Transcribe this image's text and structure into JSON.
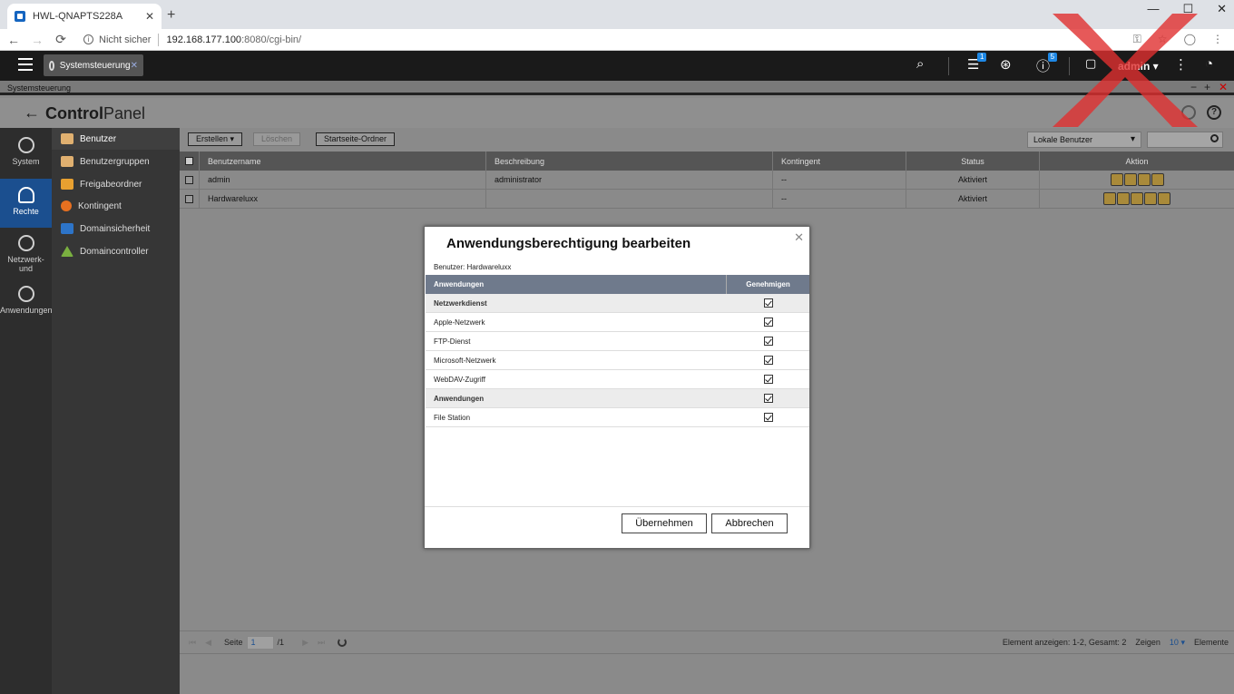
{
  "browser": {
    "tab_title": "HWL-QNAPTS228A",
    "tab_close": "✕",
    "new_tab": "+",
    "security_label": "Nicht sicher",
    "url_host": "192.168.177.100",
    "url_rest": ":8080/cgi-bin/",
    "window_controls": [
      "—",
      "☐",
      "✕"
    ]
  },
  "qnap_bar": {
    "app_tab_label": "Systemsteuerung",
    "app_tab_close": "✕",
    "tasks_badge": "1",
    "notifications_badge": "5",
    "user_label": "admin ▾"
  },
  "window": {
    "title": "Systemsteuerung",
    "controls": [
      "−",
      "+",
      "✕"
    ]
  },
  "header": {
    "back": "←",
    "title_bold": "Control",
    "title_light": "Panel"
  },
  "rail": [
    {
      "label": "System"
    },
    {
      "label": "Rechte"
    },
    {
      "label": "Netzwerk- und"
    },
    {
      "label": "Anwendungen"
    }
  ],
  "subnav": [
    {
      "label": "Benutzer",
      "color": "#e0b070"
    },
    {
      "label": "Benutzergruppen",
      "color": "#e0b070"
    },
    {
      "label": "Freigabeordner",
      "color": "#e8a030"
    },
    {
      "label": "Kontingent",
      "color": "#e87020"
    },
    {
      "label": "Domainsicherheit",
      "color": "#2d74c8"
    },
    {
      "label": "Domaincontroller",
      "color": "#7ab040"
    }
  ],
  "toolbar": {
    "create": "Erstellen ▾",
    "delete": "Löschen",
    "home_folder": "Startseite-Ordner",
    "user_filter": "Lokale Benutzer"
  },
  "grid": {
    "columns": [
      "Benutzername",
      "Beschreibung",
      "Kontingent",
      "Status",
      "Aktion"
    ],
    "rows": [
      {
        "name": "admin",
        "desc": "administrator",
        "quota": "--",
        "status": "Aktiviert"
      },
      {
        "name": "Hardwareluxx",
        "desc": "",
        "quota": "--",
        "status": "Aktiviert"
      }
    ]
  },
  "footer": {
    "page_label": "Seite",
    "page_value": "1",
    "page_total": "/1",
    "summary": "Element anzeigen: 1-2, Gesamt: 2",
    "show_label": "Zeigen",
    "show_value": "10",
    "items_label": "Elemente"
  },
  "dialog": {
    "title": "Anwendungsberechtigung bearbeiten",
    "user_line": "Benutzer: Hardwareluxx",
    "col_app": "Anwendungen",
    "col_allow": "Genehmigen",
    "rows": [
      {
        "label": "Netzwerkdienst",
        "group": true
      },
      {
        "label": "Apple-Netzwerk",
        "group": false
      },
      {
        "label": "FTP-Dienst",
        "group": false
      },
      {
        "label": "Microsoft-Netzwerk",
        "group": false
      },
      {
        "label": "WebDAV-Zugriff",
        "group": false
      },
      {
        "label": "Anwendungen",
        "group": true
      },
      {
        "label": "File Station",
        "group": false
      }
    ],
    "apply": "Übernehmen",
    "cancel": "Abbrechen"
  },
  "colors": {
    "accent": "#1b4f8f",
    "dialog_header": "#6f7a8c",
    "watermark": "#e03030"
  }
}
